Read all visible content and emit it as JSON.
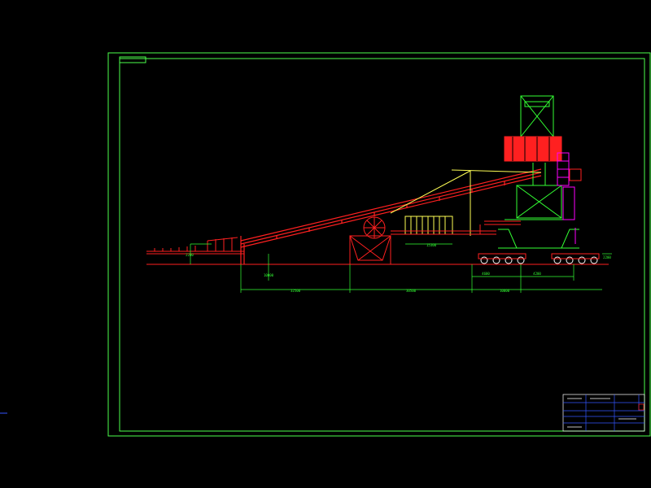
{
  "drawing": {
    "background": "#000000",
    "colors": {
      "frame": "#4CFF4C",
      "structure": "#FF2020",
      "dimension": "#33FF33",
      "tower": "#33FF33",
      "magenta": "#FF00FF",
      "yellow": "#FFFF55",
      "blue": "#3355FF",
      "white": "#FFFFFF"
    },
    "dimensions": {
      "d1": "15300",
      "d2": "4600",
      "d3": "2200",
      "d4": "32500",
      "d5": "30500",
      "d6": "10000",
      "d7": "4200",
      "d8": "10000",
      "d9": "2200"
    },
    "layers": {
      "border": "drawing-border",
      "title_block": "title-block"
    }
  }
}
